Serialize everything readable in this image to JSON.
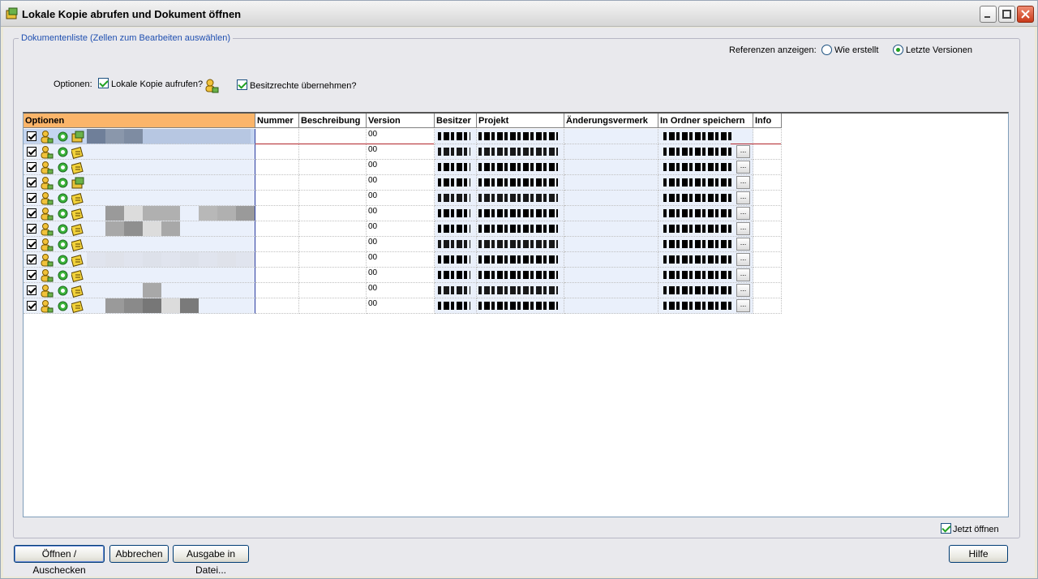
{
  "window": {
    "title": "Lokale Kopie abrufen und Dokument öffnen",
    "icons": {
      "app": "package-icon",
      "minimize": "minimize-icon",
      "maximize": "maximize-icon",
      "close": "close-icon"
    }
  },
  "group": {
    "legend": "Dokumentenliste (Zellen zum Bearbeiten auswählen)"
  },
  "references": {
    "label": "Referenzen anzeigen:",
    "options": [
      {
        "label": "Wie erstellt",
        "checked": false
      },
      {
        "label": "Letzte Versionen",
        "checked": true
      }
    ]
  },
  "options": {
    "label": "Optionen:",
    "local_copy": {
      "label": "Lokale Kopie aufrufen?",
      "checked": true,
      "icon": "user-icon"
    },
    "ownership": {
      "label": "Besitzrechte übernehmen?",
      "checked": true
    }
  },
  "grid": {
    "columns": [
      "Optionen",
      "Nummer",
      "Beschreibung",
      "Version",
      "Besitzer",
      "Projekt",
      "Änderungsvermerk",
      "In Ordner speichern",
      "Info"
    ],
    "ellipsis": "...",
    "rows": [
      {
        "version": "00"
      },
      {
        "version": "00"
      },
      {
        "version": "00"
      },
      {
        "version": "00"
      },
      {
        "version": "00"
      },
      {
        "version": "00"
      },
      {
        "version": "00"
      },
      {
        "version": "00"
      },
      {
        "version": "00"
      },
      {
        "version": "00"
      },
      {
        "version": "00"
      },
      {
        "version": "00"
      }
    ]
  },
  "footer": {
    "open_now": {
      "label": "Jetzt öffnen",
      "checked": true
    },
    "buttons": {
      "open": "Öffnen / Auschecken",
      "cancel": "Abbrechen",
      "export": "Ausgabe in Datei...",
      "help": "Hilfe"
    }
  },
  "colors": {
    "options_header": "#fbb56a",
    "accent": "#1f4fb0",
    "check": "#21a121"
  }
}
